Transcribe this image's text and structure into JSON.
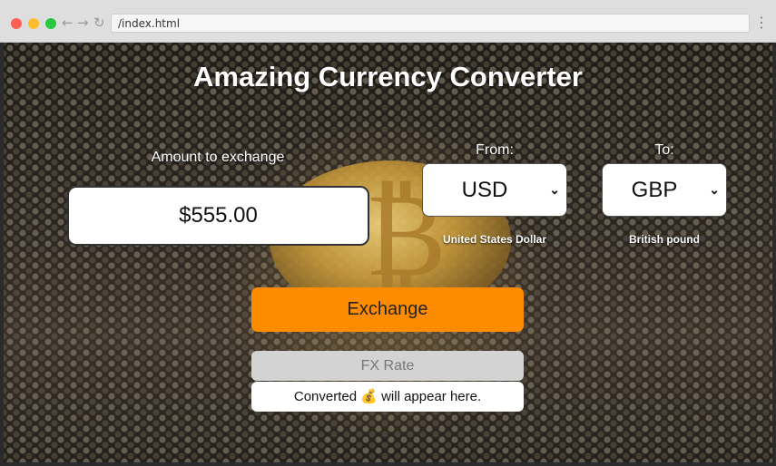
{
  "browser": {
    "url": "/index.html",
    "back_icon": "←",
    "forward_icon": "→",
    "reload_icon": "↻",
    "menu_icon": "⋮"
  },
  "page": {
    "title": "Amazing Currency Converter"
  },
  "amount": {
    "label": "Amount to exchange",
    "value": "$555.00"
  },
  "from": {
    "label": "From:",
    "selected": "USD",
    "currency_name": "United States Dollar"
  },
  "to": {
    "label": "To:",
    "selected": "GBP",
    "currency_name": "British pound"
  },
  "exchange_button": {
    "label": "Exchange",
    "color": "#ff8c00"
  },
  "fx_rate": {
    "label": "FX Rate"
  },
  "result": {
    "text": "Converted 💰 will appear here."
  },
  "icons": {
    "chevron": "⌄",
    "bitcoin": "₿"
  }
}
